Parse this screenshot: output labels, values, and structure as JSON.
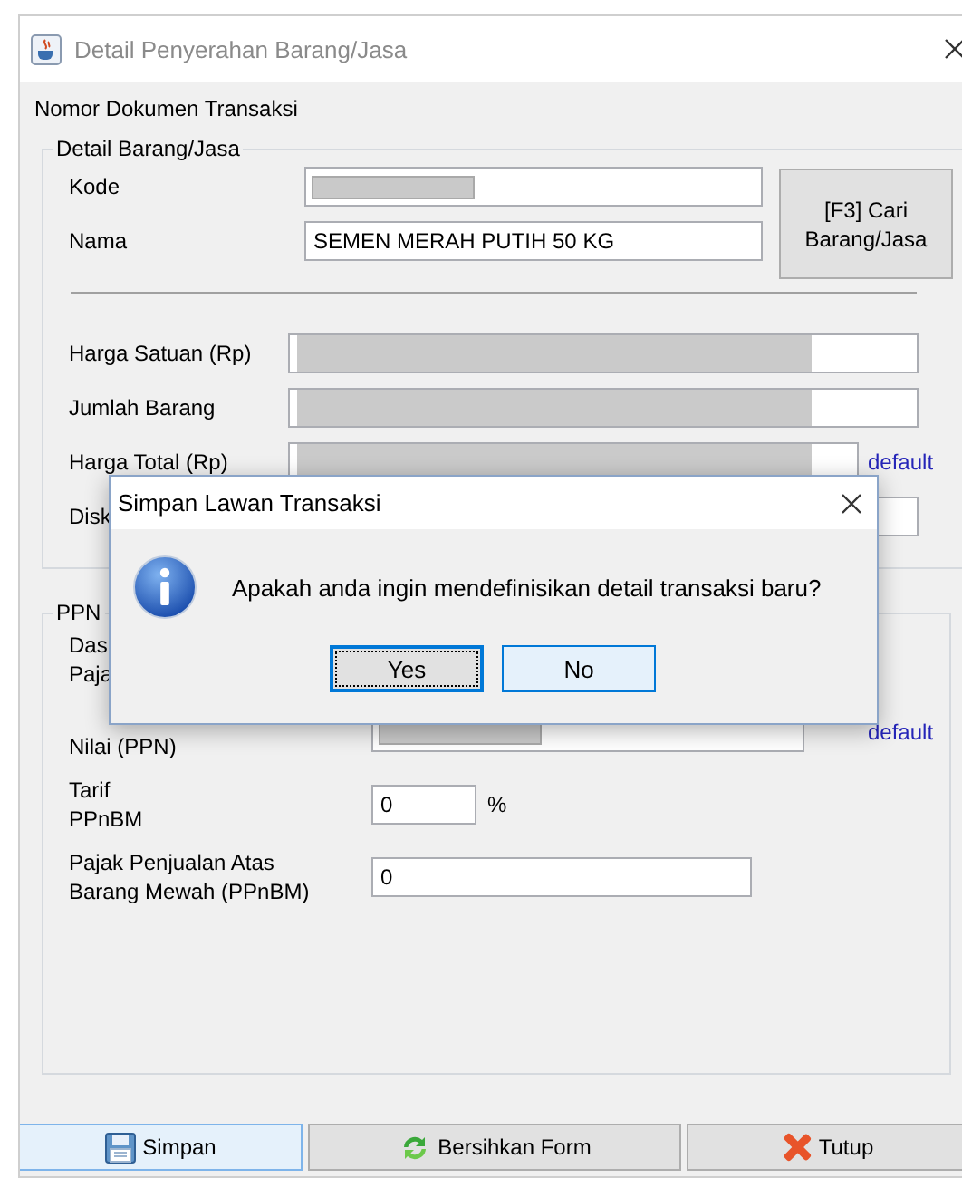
{
  "window": {
    "title": "Detail Penyerahan Barang/Jasa"
  },
  "document_label": "Nomor Dokumen Transaksi",
  "item_group": {
    "legend": "Detail Barang/Jasa",
    "fields": [
      {
        "label": "Kode",
        "redacted": true
      },
      {
        "label": "Nama",
        "value": "SEMEN MERAH PUTIH 50 KG",
        "redacted": false
      }
    ],
    "search_button": "[F3] Cari\nBarang/Jasa",
    "price_rows": [
      {
        "label": "Harga Satuan (Rp)",
        "redacted": true
      },
      {
        "label": "Jumlah Barang",
        "redacted": true
      },
      {
        "label": "Harga Total (Rp)",
        "link": "default",
        "redacted": true
      },
      {
        "label": "Disk",
        "redacted": false
      }
    ]
  },
  "ppn_group": {
    "legend": "PPN",
    "rows": [
      {
        "label": "Das\nPaja",
        "kind": "hidden"
      },
      {
        "label": "Nilai (PPN)",
        "kind": "long",
        "redacted": true,
        "link": "default"
      },
      {
        "label": "Tarif\nPPnBM",
        "kind": "short",
        "value": "0",
        "unit": "%"
      },
      {
        "label": "Pajak Penjualan Atas\nBarang Mewah (PPnBM)",
        "kind": "medium",
        "value": "0"
      }
    ]
  },
  "dialog": {
    "title": "Simpan Lawan Transaksi",
    "message": "Apakah anda ingin mendefinisikan detail transaksi baru?",
    "buttons": [
      {
        "label": "Yes",
        "focused": true
      },
      {
        "label": "No",
        "focused": false
      }
    ]
  },
  "buttons": [
    {
      "label": "Simpan",
      "kind": "save",
      "highlighted": true
    },
    {
      "label": "Bersihkan Form",
      "kind": "refresh",
      "highlighted": false
    },
    {
      "label": "Tutup",
      "kind": "close",
      "highlighted": false
    }
  ]
}
